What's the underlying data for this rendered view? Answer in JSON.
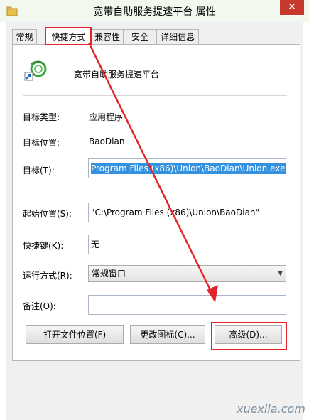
{
  "window": {
    "title": "宽带自助服务提速平台 属性",
    "close_glyph": "✕"
  },
  "tabs": [
    {
      "label": "常规",
      "active": false
    },
    {
      "label": "快捷方式",
      "active": true
    },
    {
      "label": "兼容性",
      "active": false
    },
    {
      "label": "安全",
      "active": false
    },
    {
      "label": "详细信息",
      "active": false
    }
  ],
  "app": {
    "name": "宽带自助服务提速平台",
    "icon": "app-shortcut-icon"
  },
  "fields": {
    "target_type": {
      "label": "目标类型:",
      "value": "应用程序"
    },
    "target_location": {
      "label": "目标位置:",
      "value": "BaoDian"
    },
    "target": {
      "label": "目标(T):",
      "value": "Program Files (x86)\\Union\\BaoDian\\Union.exe\""
    },
    "start_in": {
      "label": "起始位置(S):",
      "value": "\"C:\\Program Files (x86)\\Union\\BaoDian\""
    },
    "shortcut_key": {
      "label": "快捷键(K):",
      "value": "无"
    },
    "run": {
      "label": "运行方式(R):",
      "value": "常规窗口"
    },
    "comment": {
      "label": "备注(O):",
      "value": ""
    }
  },
  "buttons": {
    "open_location": "打开文件位置(F)",
    "change_icon": "更改图标(C)...",
    "advanced": "高级(D)..."
  },
  "watermark": "xuexila.com",
  "colors": {
    "highlight": "#e2252b",
    "selection": "#3392e0",
    "titlebar": "#f2f8ee"
  }
}
